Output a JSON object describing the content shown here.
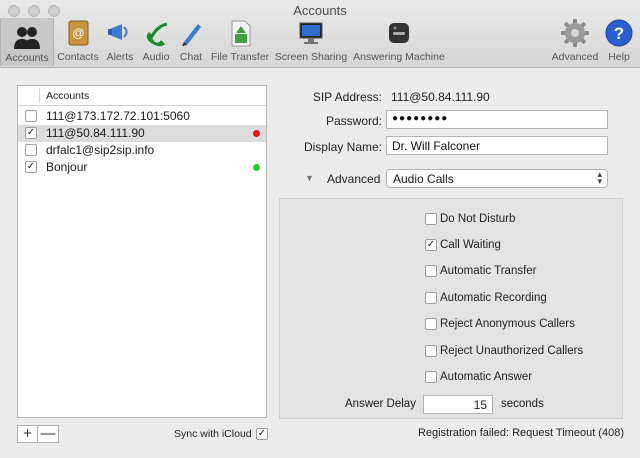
{
  "window": {
    "title": "Accounts"
  },
  "toolbar": {
    "items": [
      {
        "label": "Accounts",
        "icon": "accounts-icon"
      },
      {
        "label": "Contacts",
        "icon": "contacts-icon"
      },
      {
        "label": "Alerts",
        "icon": "alerts-icon"
      },
      {
        "label": "Audio",
        "icon": "audio-icon"
      },
      {
        "label": "Chat",
        "icon": "chat-icon"
      },
      {
        "label": "File Transfer",
        "icon": "file-transfer-icon"
      },
      {
        "label": "Screen Sharing",
        "icon": "screen-sharing-icon"
      },
      {
        "label": "Answering Machine",
        "icon": "answering-machine-icon"
      },
      {
        "label": "Advanced",
        "icon": "advanced-icon"
      },
      {
        "label": "Help",
        "icon": "help-icon"
      }
    ],
    "selected": "Accounts"
  },
  "accounts": {
    "header": "Accounts",
    "rows": [
      {
        "name": "111@173.172.72.101:5060",
        "checked": false,
        "status": null
      },
      {
        "name": "111@50.84.111.90",
        "checked": true,
        "status": "#e0181b"
      },
      {
        "name": "drfalc1@sip2sip.info",
        "checked": false,
        "status": null
      },
      {
        "name": "Bonjour",
        "checked": true,
        "status": "#1fd21f"
      }
    ],
    "add_label": "+",
    "remove_label": "—",
    "sync_label": "Sync with iCloud",
    "sync_checked": true
  },
  "form": {
    "sip_label": "SIP Address:",
    "sip_value": "111@50.84.111.90",
    "password_label": "Password:",
    "password_value": "●●●●●●●●",
    "display_label": "Display Name:",
    "display_value": "Dr. Will Falconer",
    "advanced_label": "Advanced",
    "advanced_select": "Audio Calls"
  },
  "options": [
    {
      "label": "Do Not Disturb",
      "checked": false
    },
    {
      "label": "Call Waiting",
      "checked": true
    },
    {
      "label": "Automatic Transfer",
      "checked": false
    },
    {
      "label": "Automatic Recording",
      "checked": false
    },
    {
      "label": "Reject Anonymous Callers",
      "checked": false
    },
    {
      "label": "Reject Unauthorized Callers",
      "checked": false
    },
    {
      "label": "Automatic Answer",
      "checked": false
    }
  ],
  "answer_delay": {
    "label": "Answer Delay",
    "value": "15",
    "unit": "seconds"
  },
  "status_text": "Registration failed: Request Timeout (408)",
  "colors": {
    "accent_red": "#e0181b",
    "accent_green": "#1fd21f"
  }
}
